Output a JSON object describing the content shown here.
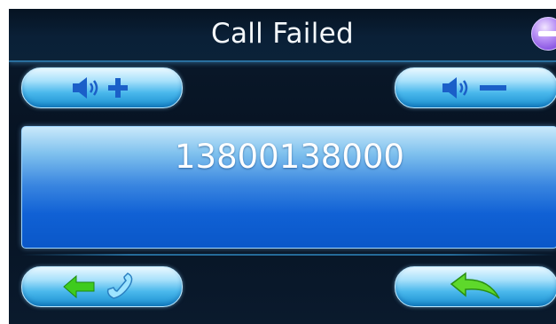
{
  "window": {
    "title": "Call Failed",
    "close_icon": "minus-circle-icon",
    "accent_color": "#1a8fd0"
  },
  "call": {
    "phone_number": "13800138000"
  },
  "controls": {
    "volume_up_icon": "speaker-plus-icon",
    "volume_down_icon": "speaker-minus-icon",
    "backspace_call_icon": "arrow-left-phone-icon",
    "return_icon": "curved-back-arrow-icon"
  }
}
